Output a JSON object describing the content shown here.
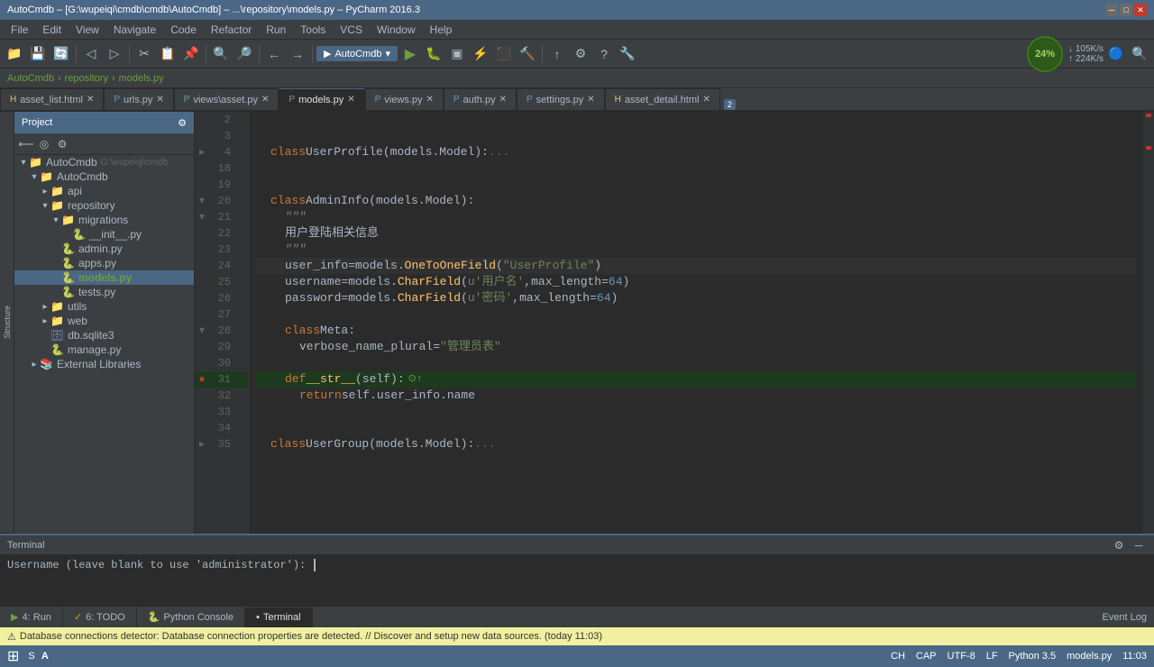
{
  "titleBar": {
    "title": "AutoCmdb – [G:\\wupeiqi\\cmdb\\cmdb\\AutoCmdb] – ...\\repository\\models.py – PyCharm 2016.3"
  },
  "menuBar": {
    "items": [
      "File",
      "Edit",
      "View",
      "Navigate",
      "Code",
      "Refactor",
      "Run",
      "Tools",
      "VCS",
      "Window",
      "Help"
    ]
  },
  "breadcrumb": {
    "items": [
      "AutoCmdb",
      "repository",
      "models.py"
    ]
  },
  "tabs": [
    {
      "label": "asset_list.html",
      "active": false,
      "icon": "html"
    },
    {
      "label": "urls.py",
      "active": false,
      "icon": "py"
    },
    {
      "label": "views\\asset.py",
      "active": false,
      "icon": "py"
    },
    {
      "label": "models.py",
      "active": true,
      "icon": "py"
    },
    {
      "label": "views.py",
      "active": false,
      "icon": "py"
    },
    {
      "label": "auth.py",
      "active": false,
      "icon": "py"
    },
    {
      "label": "settings.py",
      "active": false,
      "icon": "py"
    },
    {
      "label": "asset_detail.html",
      "active": false,
      "icon": "html"
    }
  ],
  "tabCounter": "2",
  "sidebar": {
    "header": "Project",
    "tree": [
      {
        "indent": 0,
        "label": "AutoCmdb",
        "type": "project",
        "expanded": true,
        "path": "G:\\wupeiqi\\cmdb"
      },
      {
        "indent": 1,
        "label": "AutoCmdb",
        "type": "folder",
        "expanded": true
      },
      {
        "indent": 2,
        "label": "api",
        "type": "folder",
        "expanded": false
      },
      {
        "indent": 2,
        "label": "repository",
        "type": "folder",
        "expanded": true
      },
      {
        "indent": 3,
        "label": "migrations",
        "type": "folder",
        "expanded": false
      },
      {
        "indent": 4,
        "label": "__init__.py",
        "type": "py"
      },
      {
        "indent": 3,
        "label": "admin.py",
        "type": "py"
      },
      {
        "indent": 3,
        "label": "apps.py",
        "type": "py"
      },
      {
        "indent": 3,
        "label": "models.py",
        "type": "py",
        "selected": true
      },
      {
        "indent": 3,
        "label": "tests.py",
        "type": "py"
      },
      {
        "indent": 2,
        "label": "utils",
        "type": "folder",
        "expanded": false
      },
      {
        "indent": 2,
        "label": "web",
        "type": "folder",
        "expanded": false
      },
      {
        "indent": 2,
        "label": "db.sqlite3",
        "type": "db"
      },
      {
        "indent": 2,
        "label": "manage.py",
        "type": "py"
      },
      {
        "indent": 1,
        "label": "External Libraries",
        "type": "folder",
        "expanded": false
      }
    ]
  },
  "code": {
    "lines": [
      {
        "num": "2",
        "content": "",
        "type": "blank"
      },
      {
        "num": "3",
        "content": "",
        "type": "blank"
      },
      {
        "num": "4",
        "content": "    class UserProfile(models.Model):...",
        "type": "code"
      },
      {
        "num": "18",
        "content": "",
        "type": "blank"
      },
      {
        "num": "19",
        "content": "",
        "type": "blank"
      },
      {
        "num": "20",
        "content": "    class AdminInfo(models.Model):",
        "type": "code"
      },
      {
        "num": "21",
        "content": "        \"\"\"",
        "type": "code"
      },
      {
        "num": "22",
        "content": "        用户登陆相关信息",
        "type": "code"
      },
      {
        "num": "23",
        "content": "        \"\"\"",
        "type": "code"
      },
      {
        "num": "24",
        "content": "        user_info = models.OneToOneField(\"UserProfile\")",
        "type": "code"
      },
      {
        "num": "25",
        "content": "        username = models.CharField(u'用户名', max_length=64)",
        "type": "code"
      },
      {
        "num": "26",
        "content": "        password = models.CharField(u'密码', max_length=64)",
        "type": "code"
      },
      {
        "num": "27",
        "content": "",
        "type": "blank"
      },
      {
        "num": "28",
        "content": "        class Meta:",
        "type": "code"
      },
      {
        "num": "29",
        "content": "            verbose_name_plural = \"管理员表\"",
        "type": "code"
      },
      {
        "num": "30",
        "content": "",
        "type": "blank"
      },
      {
        "num": "31",
        "content": "        def __str__(self):",
        "type": "code",
        "breakpoint": true
      },
      {
        "num": "32",
        "content": "            return self.user_info.name",
        "type": "code"
      },
      {
        "num": "33",
        "content": "",
        "type": "blank"
      },
      {
        "num": "34",
        "content": "",
        "type": "blank"
      },
      {
        "num": "35",
        "content": "    class UserGroup(models.Model):...",
        "type": "code"
      }
    ]
  },
  "bottomPanel": {
    "title": "Terminal",
    "content": "Username (leave blank to use 'administrator'):"
  },
  "bottomTabs": [
    {
      "label": "4: Run",
      "icon": "▶",
      "active": false
    },
    {
      "label": "6: TODO",
      "icon": "✓",
      "active": false
    },
    {
      "label": "Python Console",
      "icon": "🐍",
      "active": false
    },
    {
      "label": "Terminal",
      "icon": "▪",
      "active": true
    }
  ],
  "statusBar": {
    "message": "Database connections detector: Database connection properties are detected. // Discover and setup new data sources. (today 11:03)",
    "rightItems": [
      "CH",
      "CAP",
      "UTF-8",
      "LF",
      "Python 3.5",
      "models.py",
      "11:03"
    ]
  },
  "networkInfo": {
    "down": "105K/s",
    "up": "224K/s"
  },
  "percent": "24%",
  "eventLog": "Event Log"
}
